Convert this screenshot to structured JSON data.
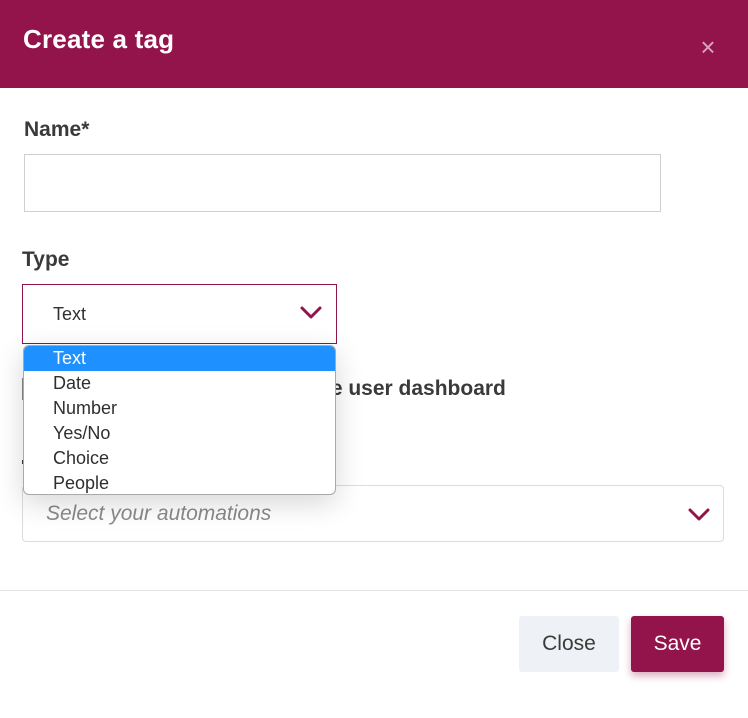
{
  "dialog": {
    "title": "Create a tag",
    "close_icon": "×"
  },
  "form": {
    "name_label": "Name*",
    "name_value": "",
    "name_placeholder": "",
    "type_label": "Type",
    "type_selected": "Text",
    "type_options": [
      "Text",
      "Date",
      "Number",
      "Yes/No",
      "Choice",
      "People"
    ],
    "dashboard_checkbox_label_visible": "he user dashboard",
    "dashboard_checked": false,
    "automations_placeholder": "Select your automations"
  },
  "footer": {
    "close_label": "Close",
    "save_label": "Save"
  },
  "colors": {
    "brand": "#93134b",
    "option_highlight": "#1e90ff",
    "close_button_bg": "#eef1f5"
  },
  "icons": {
    "close": "close-icon",
    "type_chevron": "chevron-down-icon",
    "automations_chevron": "chevron-down-icon"
  }
}
